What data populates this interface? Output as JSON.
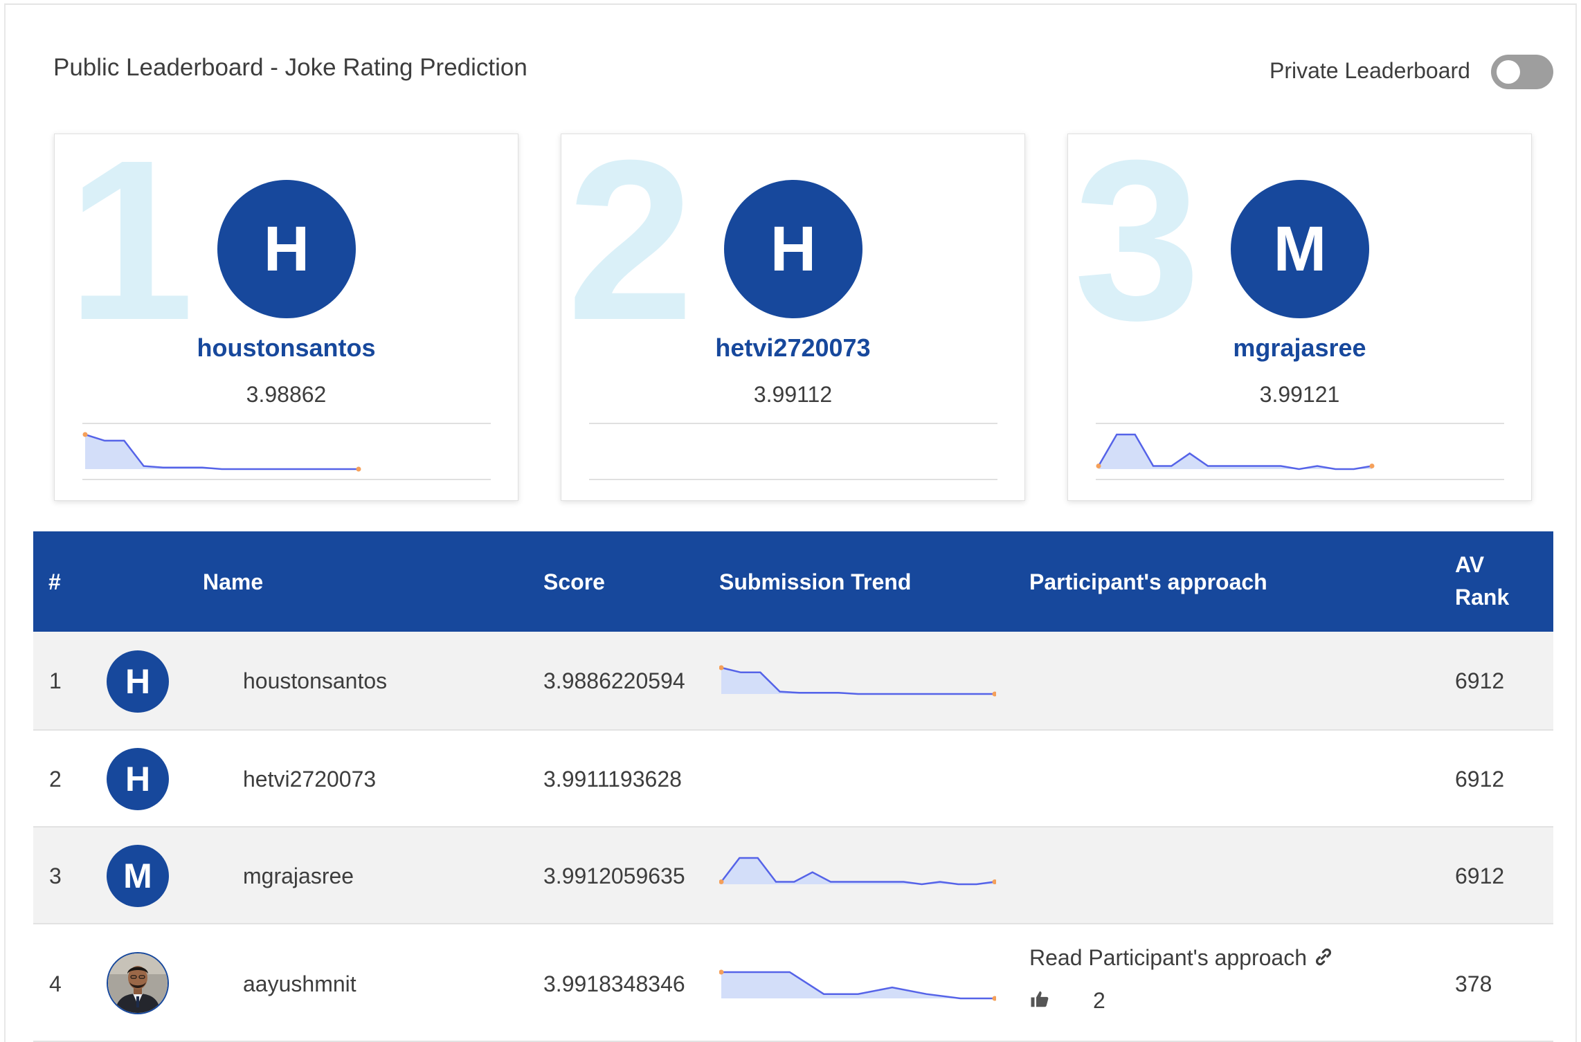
{
  "header": {
    "title": "Public Leaderboard - Joke Rating Prediction",
    "private_label": "Private Leaderboard",
    "private_toggle_on": false
  },
  "podium": [
    {
      "rank": "1",
      "initial": "H",
      "name": "houstonsantos",
      "score": "3.98862",
      "trend": [
        3.98863,
        3.98855,
        3.98855,
        3.98822,
        3.9882,
        3.9882,
        3.9882,
        3.98818,
        3.98818,
        3.98818,
        3.98818,
        3.98818,
        3.98818,
        3.98818,
        3.98818
      ]
    },
    {
      "rank": "2",
      "initial": "H",
      "name": "hetvi2720073",
      "score": "3.99112",
      "trend": []
    },
    {
      "rank": "3",
      "initial": "M",
      "name": "mgrajasree",
      "score": "3.99121",
      "trend": [
        3.991,
        3.992,
        3.992,
        3.991,
        3.991,
        3.9914,
        3.991,
        3.991,
        3.991,
        3.991,
        3.991,
        3.9909,
        3.991,
        3.9909,
        3.9909,
        3.991
      ]
    }
  ],
  "table": {
    "headers": {
      "rank": "#",
      "name": "Name",
      "score": "Score",
      "trend": "Submission Trend",
      "approach": "Participant's approach",
      "av_rank_line1": "AV",
      "av_rank_line2": "Rank"
    },
    "rows": [
      {
        "rank": "1",
        "initial": "H",
        "name": "houstonsantos",
        "score": "3.9886220594",
        "trend": [
          3.98863,
          3.98855,
          3.98855,
          3.98822,
          3.9882,
          3.9882,
          3.9882,
          3.98818,
          3.98818,
          3.98818,
          3.98818,
          3.98818,
          3.98818,
          3.98818,
          3.98818
        ],
        "approach": "",
        "likes": "",
        "av_rank": "6912"
      },
      {
        "rank": "2",
        "initial": "H",
        "name": "hetvi2720073",
        "score": "3.9911193628",
        "trend": [],
        "approach": "",
        "likes": "",
        "av_rank": "6912"
      },
      {
        "rank": "3",
        "initial": "M",
        "name": "mgrajasree",
        "score": "3.9912059635",
        "trend": [
          3.991,
          3.992,
          3.992,
          3.991,
          3.991,
          3.9914,
          3.991,
          3.991,
          3.991,
          3.991,
          3.991,
          3.9909,
          3.991,
          3.9909,
          3.9909,
          3.991
        ],
        "approach": "",
        "likes": "",
        "av_rank": "6912"
      },
      {
        "rank": "4",
        "initial": "",
        "name": "aayushmnit",
        "score": "3.9918348346",
        "trend": [
          3.9925,
          3.9925,
          3.9925,
          3.9915,
          3.9915,
          3.9918,
          3.9915,
          3.9913,
          3.9913
        ],
        "approach": "Read Participant's approach",
        "likes": "2",
        "av_rank": "378"
      }
    ]
  },
  "colors": {
    "brand": "#17489c",
    "rank_watermark": "#daf0f8",
    "spark_line": "#5563e8",
    "spark_fill": "#d3def9",
    "spark_dot": "#f5a05a",
    "toggle_off": "#9e9e9e"
  },
  "icons": {
    "link": "link-icon",
    "like": "thumbs-up-icon"
  }
}
